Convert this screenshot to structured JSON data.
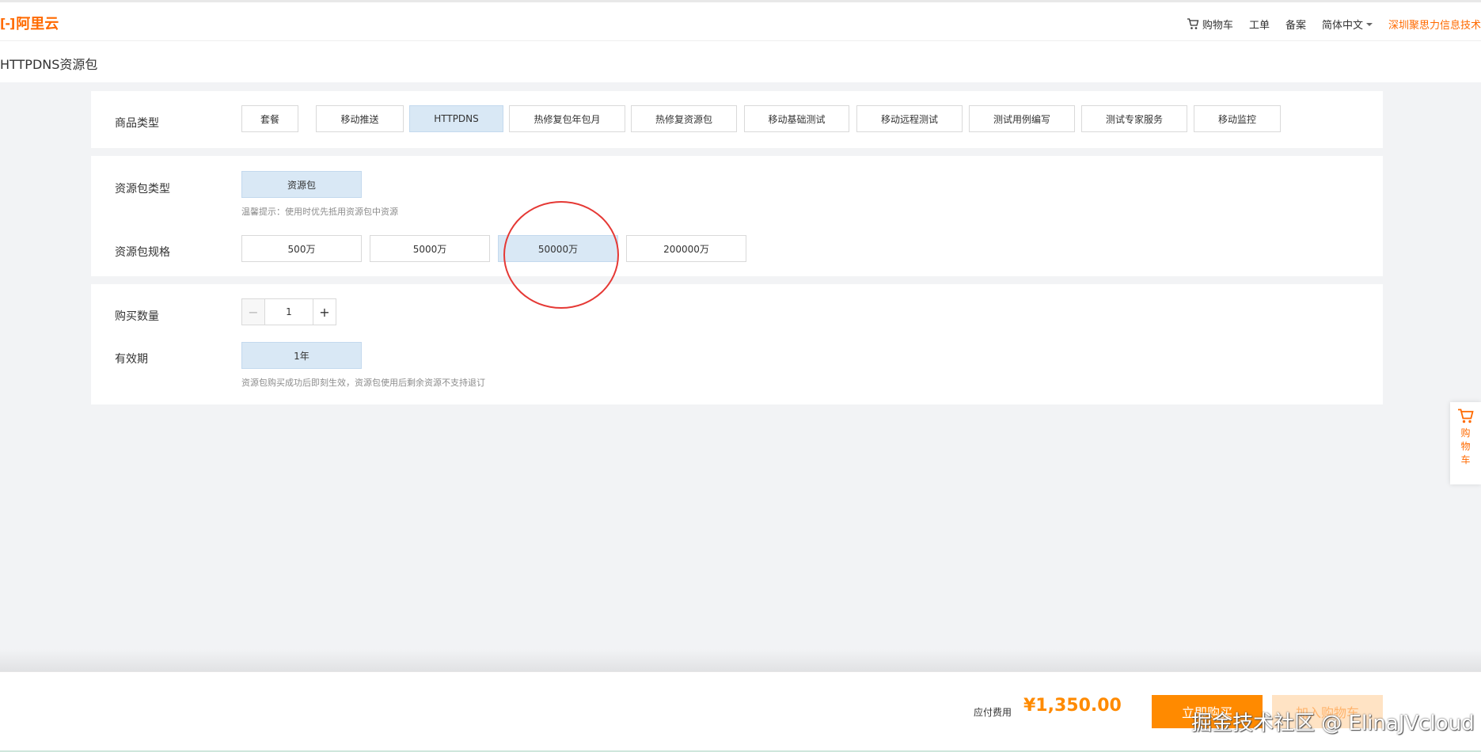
{
  "header": {
    "logo_text": "阿里云",
    "logo_mark": "[-]",
    "nav": {
      "cart": "购物车",
      "ticket": "工单",
      "record": "备案",
      "language": "简体中文",
      "account": "深圳聚思力信息技术"
    }
  },
  "page_title": "HTTPDNS资源包",
  "product_type": {
    "label": "商品类型",
    "options": [
      "套餐",
      "移动推送",
      "HTTPDNS",
      "热修复包年包月",
      "热修复资源包",
      "移动基础测试",
      "移动远程测试",
      "测试用例编写",
      "测试专家服务",
      "移动监控"
    ],
    "selected": "HTTPDNS"
  },
  "package_type": {
    "label": "资源包类型",
    "option": "资源包",
    "hint": "温馨提示：使用时优先抵用资源包中资源"
  },
  "package_spec": {
    "label": "资源包规格",
    "options": [
      "500万",
      "5000万",
      "50000万",
      "200000万"
    ],
    "selected": "50000万"
  },
  "quantity": {
    "label": "购买数量",
    "value": "1",
    "minus": "−",
    "plus": "+"
  },
  "validity": {
    "label": "有效期",
    "option": "1年",
    "hint": "资源包购买成功后即刻生效，资源包使用后剩余资源不支持退订"
  },
  "side_cart": {
    "label": "购物车"
  },
  "footer": {
    "fee_label": "应付费用",
    "price": "¥1,350.00",
    "buy_now": "立即购买",
    "add_to_cart": "加入购物车",
    "watermark": "掘金技术社区 @ ElinaJVcloud"
  },
  "colors": {
    "brand": "#ff6a00",
    "price": "#ff8a00",
    "selected_bg": "#d9e8f5",
    "annotation": "#e53935"
  }
}
